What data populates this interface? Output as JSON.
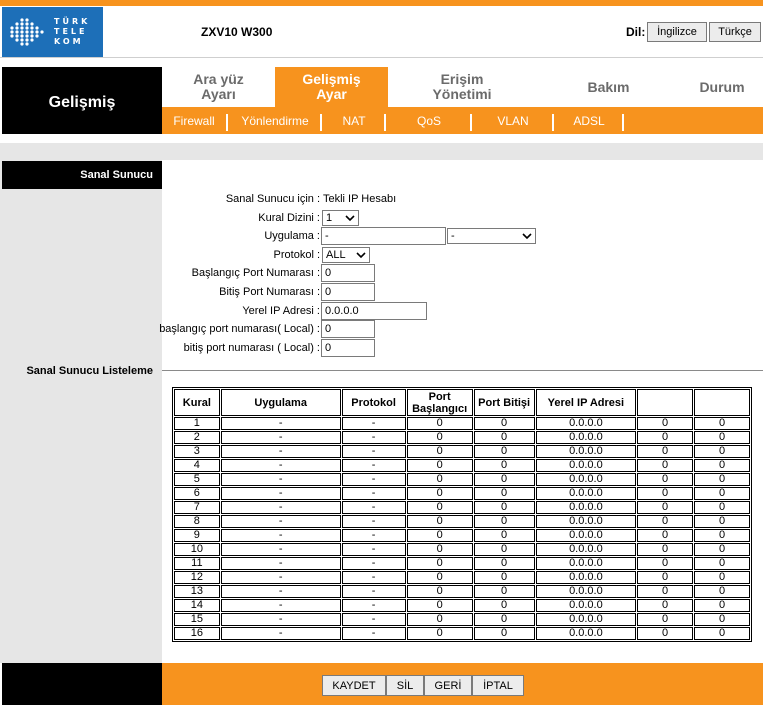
{
  "header": {
    "logo_lines": [
      "TÜRK",
      "TELE",
      "KOM"
    ],
    "model": "ZXV10 W300",
    "language_label": "Dil:",
    "language_buttons": [
      "İngilizce",
      "Türkçe"
    ]
  },
  "colors": {
    "accent": "#f7931e",
    "brand": "#1d6fb8",
    "dark": "#000000"
  },
  "section_title": "Gelişmiş",
  "nav_tabs": [
    {
      "line1": "Ara yüz",
      "line2": "Ayarı",
      "active": false
    },
    {
      "line1": "Gelişmiş",
      "line2": "Ayar",
      "active": true
    },
    {
      "line1": "Erişim",
      "line2": "Yönetimi",
      "active": false
    },
    {
      "line1": "Bakım",
      "line2": "",
      "active": false
    },
    {
      "line1": "Durum",
      "line2": "",
      "active": false
    }
  ],
  "sub_tabs": [
    "Firewall",
    "Yönlendirme",
    "NAT",
    "QoS",
    "VLAN",
    "ADSL"
  ],
  "left": {
    "virtual_server": "Sanal Sunucu",
    "virtual_server_list": "Sanal Sunucu Listeleme"
  },
  "form": {
    "for_label": "Sanal Sunucu için :",
    "for_value": "Tekli IP Hesabı",
    "rule_index_label": "Kural Dizini :",
    "rule_index_value": "1",
    "application_label": "Uygulama :",
    "application_value": "-",
    "application_select": "-",
    "protocol_label": "Protokol :",
    "protocol_value": "ALL",
    "start_port_label": "Başlangıç Port Numarası :",
    "start_port_value": "0",
    "end_port_label": "Bitiş Port Numarası :",
    "end_port_value": "0",
    "local_ip_label": "Yerel IP Adresi :",
    "local_ip_value": "0.0.0.0",
    "local_start_label": "başlangıç port numarası( Local) :",
    "local_start_value": "0",
    "local_end_label": "bitiş port numarası ( Local) :",
    "local_end_value": "0"
  },
  "table": {
    "headers": [
      "Kural",
      "Uygulama",
      "Protokol",
      "Port Başlangıcı",
      "Port Bitişi",
      "Yerel IP Adresi",
      "",
      ""
    ],
    "rows": [
      [
        "1",
        "-",
        "-",
        "0",
        "0",
        "0.0.0.0",
        "0",
        "0"
      ],
      [
        "2",
        "-",
        "-",
        "0",
        "0",
        "0.0.0.0",
        "0",
        "0"
      ],
      [
        "3",
        "-",
        "-",
        "0",
        "0",
        "0.0.0.0",
        "0",
        "0"
      ],
      [
        "4",
        "-",
        "-",
        "0",
        "0",
        "0.0.0.0",
        "0",
        "0"
      ],
      [
        "5",
        "-",
        "-",
        "0",
        "0",
        "0.0.0.0",
        "0",
        "0"
      ],
      [
        "6",
        "-",
        "-",
        "0",
        "0",
        "0.0.0.0",
        "0",
        "0"
      ],
      [
        "7",
        "-",
        "-",
        "0",
        "0",
        "0.0.0.0",
        "0",
        "0"
      ],
      [
        "8",
        "-",
        "-",
        "0",
        "0",
        "0.0.0.0",
        "0",
        "0"
      ],
      [
        "9",
        "-",
        "-",
        "0",
        "0",
        "0.0.0.0",
        "0",
        "0"
      ],
      [
        "10",
        "-",
        "-",
        "0",
        "0",
        "0.0.0.0",
        "0",
        "0"
      ],
      [
        "11",
        "-",
        "-",
        "0",
        "0",
        "0.0.0.0",
        "0",
        "0"
      ],
      [
        "12",
        "-",
        "-",
        "0",
        "0",
        "0.0.0.0",
        "0",
        "0"
      ],
      [
        "13",
        "-",
        "-",
        "0",
        "0",
        "0.0.0.0",
        "0",
        "0"
      ],
      [
        "14",
        "-",
        "-",
        "0",
        "0",
        "0.0.0.0",
        "0",
        "0"
      ],
      [
        "15",
        "-",
        "-",
        "0",
        "0",
        "0.0.0.0",
        "0",
        "0"
      ],
      [
        "16",
        "-",
        "-",
        "0",
        "0",
        "0.0.0.0",
        "0",
        "0"
      ]
    ]
  },
  "actions": [
    "KAYDET",
    "SİL",
    "GERİ",
    "İPTAL"
  ]
}
